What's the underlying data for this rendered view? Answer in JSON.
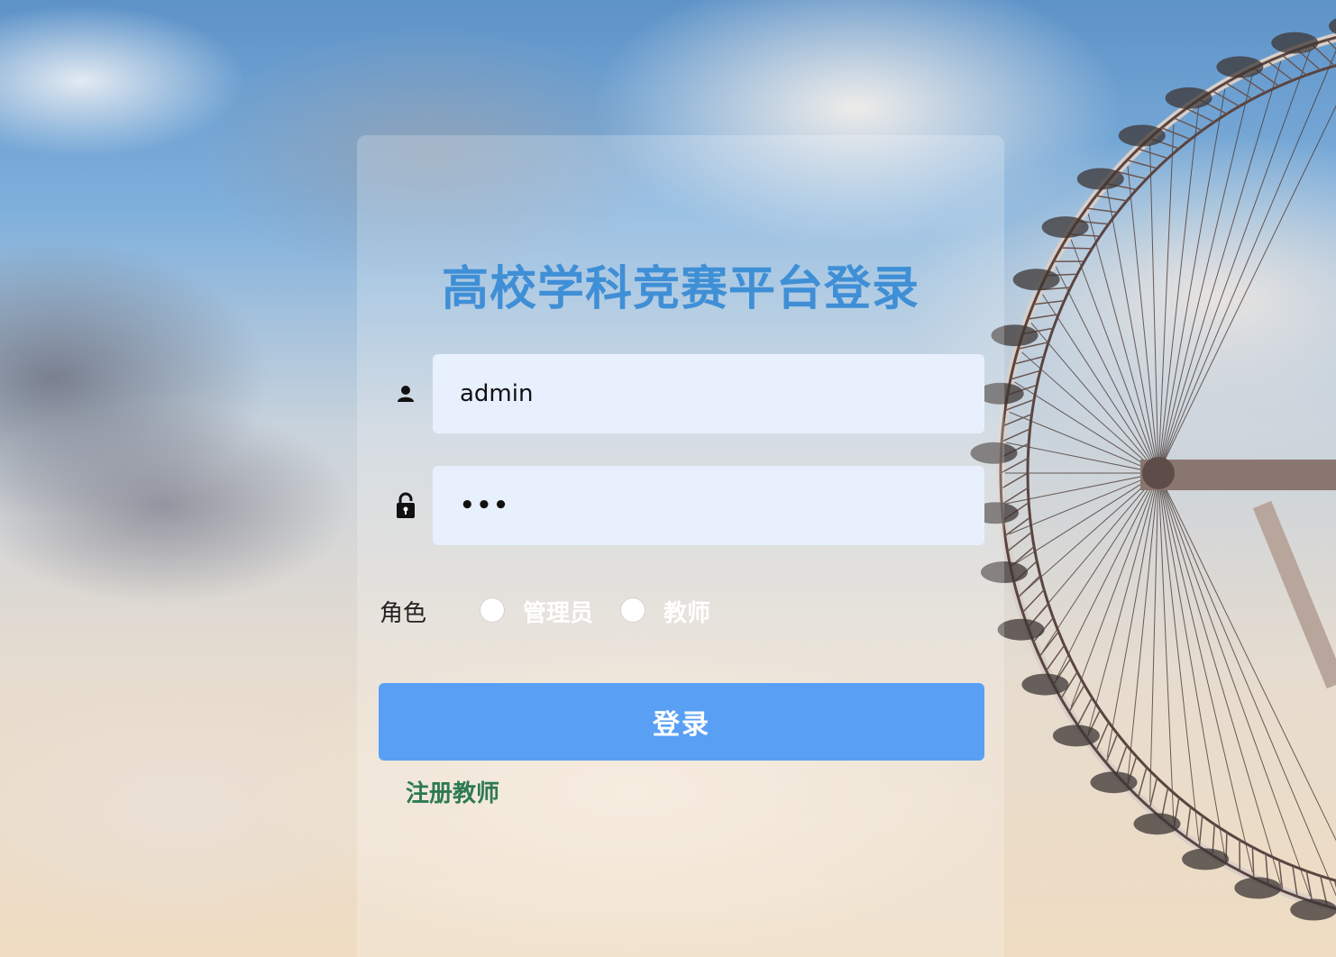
{
  "page": {
    "title": "高校学科竞赛平台登录"
  },
  "login_form": {
    "username": {
      "value": "admin",
      "icon": "user-icon"
    },
    "password": {
      "value": "•••",
      "icon": "lock-icon"
    },
    "role": {
      "label": "角色",
      "options": [
        {
          "label": "管理员",
          "selected": false
        },
        {
          "label": "教师",
          "selected": false
        }
      ]
    },
    "submit_label": "登录",
    "register_link": "注册教师"
  },
  "colors": {
    "title": "#3f8fd6",
    "input_bg": "#e8f0fe",
    "button": "#59a0f5",
    "link": "#2d7a52"
  }
}
